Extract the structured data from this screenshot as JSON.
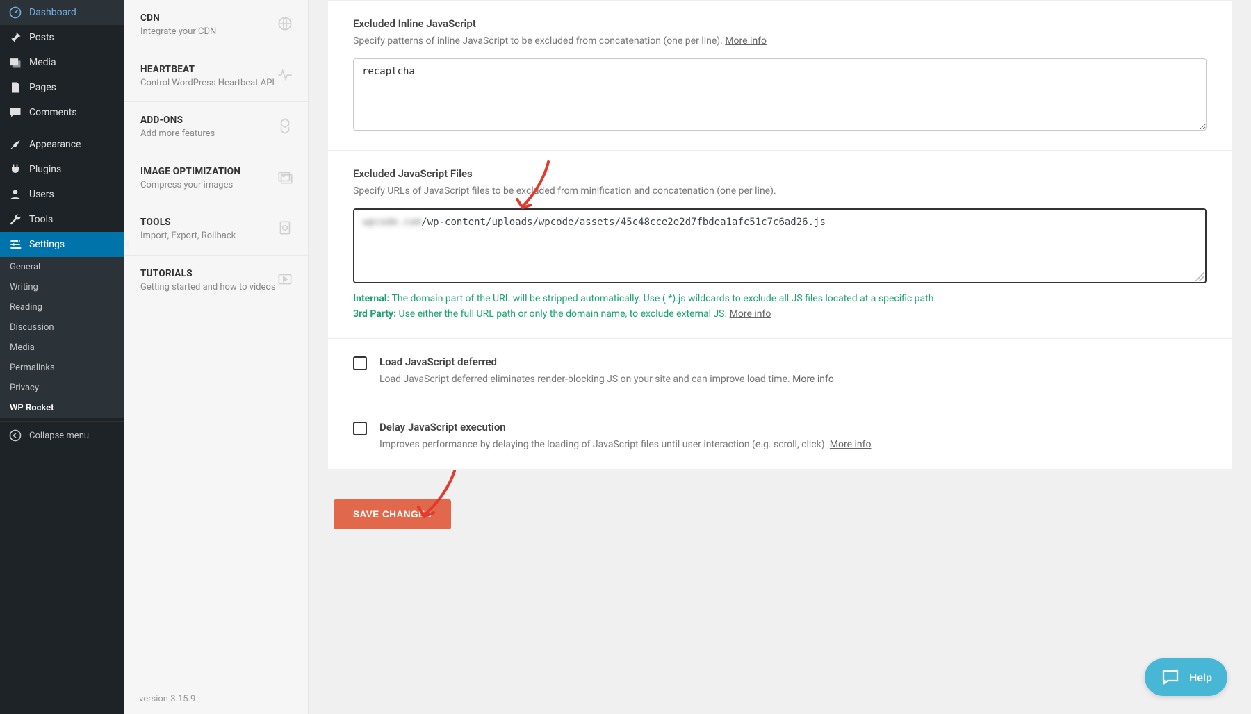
{
  "wp_menu": {
    "dashboard": "Dashboard",
    "posts": "Posts",
    "media": "Media",
    "pages": "Pages",
    "comments": "Comments",
    "appearance": "Appearance",
    "plugins": "Plugins",
    "users": "Users",
    "tools": "Tools",
    "settings": "Settings"
  },
  "settings_submenu": [
    "General",
    "Writing",
    "Reading",
    "Discussion",
    "Media",
    "Permalinks",
    "Privacy",
    "WP Rocket"
  ],
  "collapse_label": "Collapse menu",
  "tabs": {
    "cdn": {
      "title": "CDN",
      "desc": "Integrate your CDN"
    },
    "heartbeat": {
      "title": "HEARTBEAT",
      "desc": "Control WordPress Heartbeat API"
    },
    "addons": {
      "title": "ADD-ONS",
      "desc": "Add more features"
    },
    "imgopt": {
      "title": "IMAGE OPTIMIZATION",
      "desc": "Compress your images"
    },
    "tools": {
      "title": "TOOLS",
      "desc": "Import, Export, Rollback"
    },
    "tutorials": {
      "title": "TUTORIALS",
      "desc": "Getting started and how to videos"
    }
  },
  "version_label": "version 3.15.9",
  "section_inline": {
    "title": "Excluded Inline JavaScript",
    "desc": "Specify patterns of inline JavaScript to be excluded from concatenation (one per line). ",
    "more": "More info",
    "value": "recaptcha"
  },
  "section_files": {
    "title": "Excluded JavaScript Files",
    "desc": "Specify URLs of JavaScript files to be excluded from minification and concatenation (one per line).",
    "value_blurred": "wpcode.com",
    "value_clear": "/wp-content/uploads/wpcode/assets/45c48cce2e2d7fbdea1afc51c7c6ad26.js",
    "hint_internal_label": "Internal:",
    "hint_internal": " The domain part of the URL will be stripped automatically. Use (.*).js wildcards to exclude all JS files located at a specific path.",
    "hint_3rd_label": "3rd Party:",
    "hint_3rd": " Use either the full URL path or only the domain name, to exclude external JS. ",
    "more": "More info"
  },
  "section_defer": {
    "title": "Load JavaScript deferred",
    "desc": "Load JavaScript deferred eliminates render-blocking JS on your site and can improve load time. ",
    "more": "More info"
  },
  "section_delay": {
    "title": "Delay JavaScript execution",
    "desc": "Improves performance by delaying the loading of JavaScript files until user interaction (e.g. scroll, click). ",
    "more": "More info"
  },
  "save_button": "SAVE CHANGES",
  "help_label": "Help"
}
